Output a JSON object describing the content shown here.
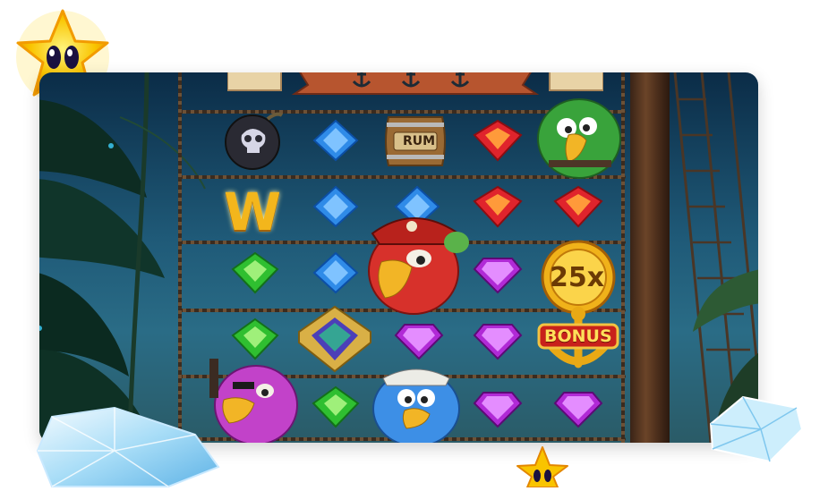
{
  "symbols": {
    "wild": "W",
    "rum": "RUM",
    "multiplier": "25x",
    "bonus": "BONUS"
  },
  "colors": {
    "sea_top": "#0b2c47",
    "sea_mid": "#2a6c86",
    "blue_gem": "#2f8be8",
    "red_gem": "#e0242c",
    "green_gem": "#2fbf30",
    "purple_gem": "#b12ad6",
    "gold": "#f3b61c",
    "star": "#f9c400"
  },
  "grid": {
    "rows": [
      [
        "bomb",
        "blue-gem",
        "rum-barrel",
        "red-gem",
        "green-parrot"
      ],
      [
        "wild",
        "blue-gem",
        "blue-gem",
        "red-gem",
        "red-gem"
      ],
      [
        "green-gem",
        "blue-gem",
        "red-parrot",
        "purple-gem",
        "multiplier-25x"
      ],
      [
        "green-gem",
        "house-gem",
        "purple-gem",
        "purple-gem",
        "bonus-anchor"
      ],
      [
        "pink-parrot",
        "green-gem",
        "blue-parrot",
        "purple-gem",
        "purple-gem"
      ]
    ]
  }
}
